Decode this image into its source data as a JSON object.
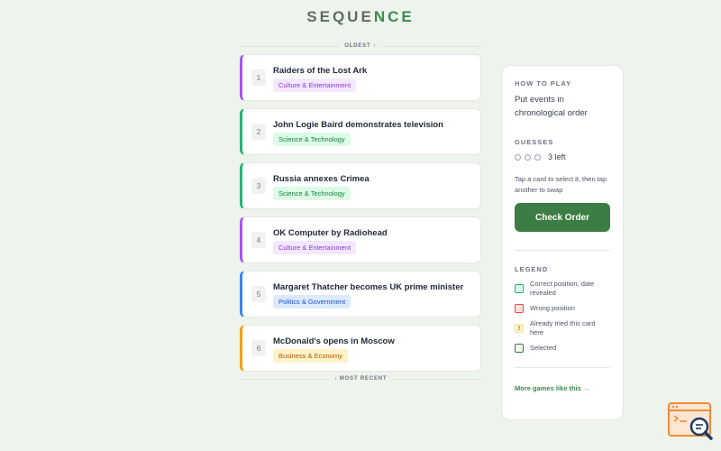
{
  "logo": {
    "part1": "SEQUE",
    "part2": "NCE"
  },
  "markers": {
    "top": "OLDEST ↑",
    "bottom": "↓ MOST RECENT"
  },
  "cards": [
    {
      "num": "1",
      "title": "Raiders of the Lost Ark",
      "category": "Culture & Entertainment",
      "color": "purple"
    },
    {
      "num": "2",
      "title": "John Logie Baird demonstrates television",
      "category": "Science & Technology",
      "color": "green"
    },
    {
      "num": "3",
      "title": "Russia annexes Crimea",
      "category": "Science & Technology",
      "color": "green"
    },
    {
      "num": "4",
      "title": "OK Computer by Radiohead",
      "category": "Culture & Entertainment",
      "color": "purple"
    },
    {
      "num": "5",
      "title": "Margaret Thatcher becomes UK prime minister",
      "category": "Politics & Government",
      "color": "blue"
    },
    {
      "num": "6",
      "title": "McDonald's opens in Moscow",
      "category": "Business & Economy",
      "color": "orange"
    }
  ],
  "panel": {
    "howto_label": "HOW TO PLAY",
    "howto_text": "Put events in chronological order",
    "guesses_label": "GUESSES",
    "guesses_left": "3 left",
    "hint": "Tap a card to select it, then tap another to swap",
    "check_button": "Check Order",
    "legend_label": "LEGEND",
    "legend": [
      {
        "label": "Correct position, date revealed",
        "icon": "",
        "kind": "correct"
      },
      {
        "label": "Wrong position",
        "icon": "",
        "kind": "wrong"
      },
      {
        "label": "Already tried this card here",
        "icon": "!",
        "kind": "tried"
      },
      {
        "label": "Selected",
        "icon": "",
        "kind": "selected"
      }
    ],
    "more_link": "More games like this →"
  },
  "colors": {
    "accent": "#3b7d42",
    "brand_green": "#3d8a4e",
    "background": "#eef4ec"
  }
}
